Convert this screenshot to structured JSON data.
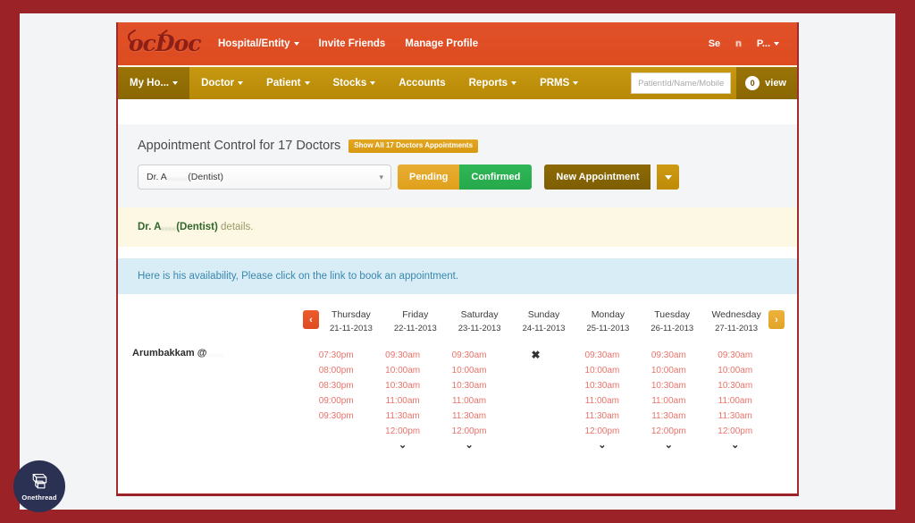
{
  "brand": {
    "logo_text": "ocDoc",
    "logo_name": "DocDoc"
  },
  "topbar": {
    "nav": [
      {
        "label": "Hospital/Entity",
        "has_caret": true
      },
      {
        "label": "Invite Friends",
        "has_caret": false
      },
      {
        "label": "Manage Profile",
        "has_caret": false
      }
    ],
    "right": [
      {
        "label": "Se",
        "redacted": ""
      },
      {
        "label": "",
        "redacted": "n"
      },
      {
        "label": "P...",
        "has_caret": true
      }
    ]
  },
  "navbar": {
    "items": [
      {
        "label": "My Ho...",
        "has_caret": true,
        "active": true
      },
      {
        "label": "Doctor",
        "has_caret": true,
        "active": false
      },
      {
        "label": "Patient",
        "has_caret": true,
        "active": false
      },
      {
        "label": "Stocks",
        "has_caret": true,
        "active": false
      },
      {
        "label": "Accounts",
        "has_caret": false,
        "active": false
      },
      {
        "label": "Reports",
        "has_caret": true,
        "active": false
      },
      {
        "label": "PRMS",
        "has_caret": true,
        "active": false
      }
    ],
    "search_placeholder": "PatientId/Name/Mobile",
    "view_count": "0",
    "view_label": "view"
  },
  "control": {
    "title": "Appointment Control for 17 Doctors",
    "show_all_badge": "Show All 17 Doctors Appointments",
    "doctor_select_prefix": "Dr. A",
    "doctor_select_redacted": "......",
    "doctor_select_suffix": "(Dentist)",
    "select_caret": "▾",
    "pending_label": "Pending",
    "confirmed_label": "Confirmed",
    "new_appointment_label": "New Appointment"
  },
  "notices": {
    "doctor_details_prefix": "Dr. A",
    "doctor_details_redacted": "....",
    "doctor_details_bold": "(Dentist)",
    "doctor_details_suffix": " details.",
    "availability": "Here is his availability, Please click on the link to book an appointment."
  },
  "calendar": {
    "prev_arrow": "‹",
    "next_arrow": "›",
    "venue_label": "Arumbakkam @",
    "venue_redacted": "....",
    "more_caret": "⌄",
    "no_slots_mark": "✖",
    "days": [
      {
        "name": "Thursday",
        "date": "21-11-2013",
        "slots": [
          "07:30pm",
          "08:00pm",
          "08:30pm",
          "09:00pm",
          "09:30pm"
        ],
        "has_more": false,
        "available": true
      },
      {
        "name": "Friday",
        "date": "22-11-2013",
        "slots": [
          "09:30am",
          "10:00am",
          "10:30am",
          "11:00am",
          "11:30am",
          "12:00pm"
        ],
        "has_more": true,
        "available": true
      },
      {
        "name": "Saturday",
        "date": "23-11-2013",
        "slots": [
          "09:30am",
          "10:00am",
          "10:30am",
          "11:00am",
          "11:30am",
          "12:00pm"
        ],
        "has_more": true,
        "available": true
      },
      {
        "name": "Sunday",
        "date": "24-11-2013",
        "slots": [],
        "has_more": false,
        "available": false
      },
      {
        "name": "Monday",
        "date": "25-11-2013",
        "slots": [
          "09:30am",
          "10:00am",
          "10:30am",
          "11:00am",
          "11:30am",
          "12:00pm"
        ],
        "has_more": true,
        "available": true
      },
      {
        "name": "Tuesday",
        "date": "26-11-2013",
        "slots": [
          "09:30am",
          "10:00am",
          "10:30am",
          "11:00am",
          "11:30am",
          "12:00pm"
        ],
        "has_more": true,
        "available": true
      },
      {
        "name": "Wednesday",
        "date": "27-11-2013",
        "slots": [
          "09:30am",
          "10:00am",
          "10:30am",
          "11:00am",
          "11:30am",
          "12:00pm"
        ],
        "has_more": true,
        "available": true
      }
    ]
  },
  "watermark": {
    "label": "Onethread"
  },
  "colors": {
    "frame": "#9B2226",
    "topbar": "#e04b22",
    "navbar": "#c19108",
    "nav_active": "#8d6a04",
    "pending": "#dfa01b",
    "confirmed": "#26a94b",
    "slot_text": "#e8736a",
    "notice_yellow_bg": "#fcf8e3",
    "notice_blue_bg": "#d9edf7",
    "watermark_bg": "#2b3153"
  }
}
